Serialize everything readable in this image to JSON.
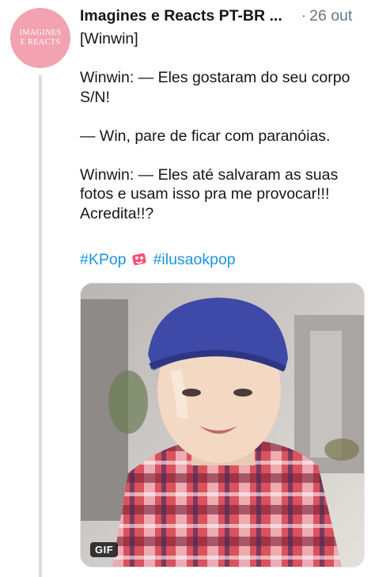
{
  "tweet": {
    "avatar_text_line1": "IMAGINES",
    "avatar_text_line2": "E REACTS",
    "author": "Imagines e Reacts PT-BR ...",
    "date_separator": "·",
    "date": "26 out",
    "lines": [
      "[Winwin]",
      "",
      "Winwin: — Eles gostaram do seu corpo",
      "S/N!",
      "",
      "— Win, pare de ficar com paranóias.",
      "",
      "Winwin: — Eles até salvaram as suas",
      "fotos e usam isso pra me provocar!!!",
      "Acredita!!?"
    ],
    "hashtags": [
      "#KPop",
      "#ilusaokpop"
    ]
  },
  "media": {
    "type": "gif",
    "badge": "GIF"
  },
  "colors": {
    "avatar_bg": "#f2a2b0",
    "hashtag": "#1b95e0",
    "muted": "#657786",
    "thread_line": "#d9dde1"
  },
  "icons": {
    "menu": "chevron-down-icon",
    "kpop_emoji": "kpop-hashflag-icon"
  }
}
